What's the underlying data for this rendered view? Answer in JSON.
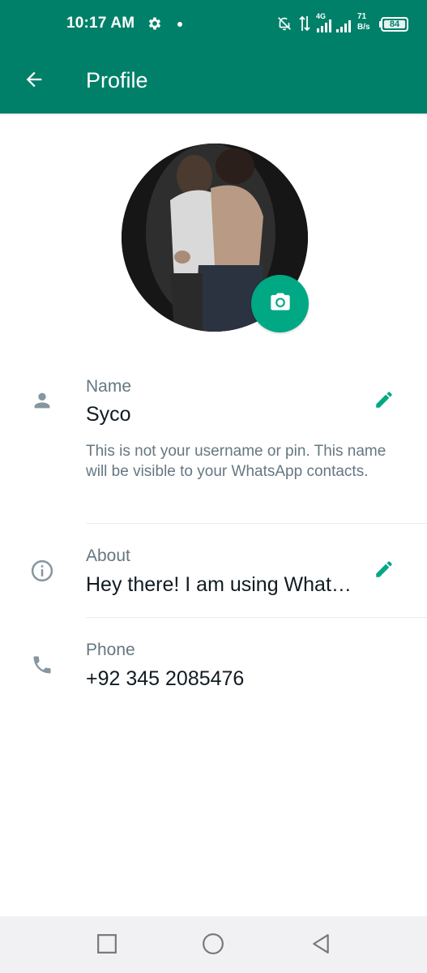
{
  "status_bar": {
    "time": "10:17 AM",
    "network_type": "4G",
    "speed_value": "71",
    "speed_unit": "B/s",
    "battery": "84",
    "icons": [
      "gear-icon",
      "notification-dot",
      "bell-off-icon",
      "data-arrows-icon",
      "signal-icon",
      "battery-icon"
    ]
  },
  "app_bar": {
    "title": "Profile",
    "back_icon": "arrow-left-icon"
  },
  "profile": {
    "camera_icon": "camera-icon"
  },
  "fields": {
    "name": {
      "label": "Name",
      "value": "Syco",
      "helper": "This is not your username or pin. This name will be visible to your WhatsApp contacts.",
      "icon": "person-icon",
      "edit_icon": "pencil-icon"
    },
    "about": {
      "label": "About",
      "value": "Hey there! I am using What…",
      "icon": "info-icon",
      "edit_icon": "pencil-icon"
    },
    "phone": {
      "label": "Phone",
      "value": "+92 345 2085476",
      "icon": "phone-icon"
    }
  },
  "nav_bar": {
    "icons": [
      "recents-square-icon",
      "home-circle-icon",
      "back-triangle-icon"
    ]
  },
  "colors": {
    "header": "#008069",
    "accent": "#00a884",
    "secondary_text": "#667781",
    "icon_gray": "#8696a0"
  }
}
